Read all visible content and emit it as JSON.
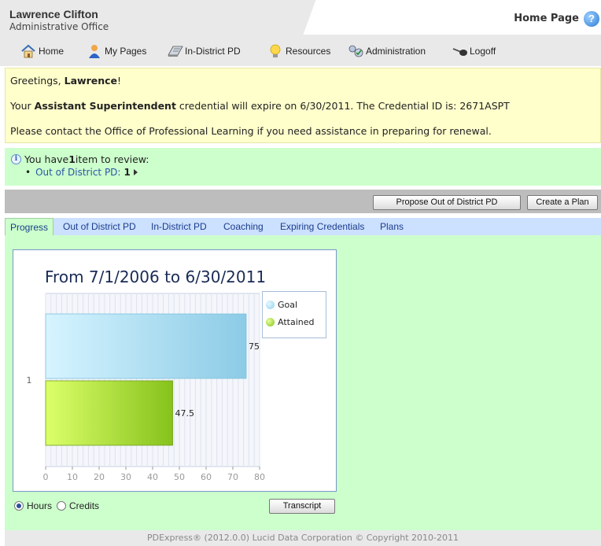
{
  "header": {
    "user_name": "Lawrence Clifton",
    "office": "Administrative Office",
    "page_title": "Home Page",
    "help_icon": "help-icon"
  },
  "nav": {
    "items": [
      {
        "label": "Home",
        "icon": "home-icon"
      },
      {
        "label": "My Pages",
        "icon": "user-icon"
      },
      {
        "label": "In-District PD",
        "icon": "book-icon"
      },
      {
        "label": "Resources",
        "icon": "lightbulb-icon"
      },
      {
        "label": "Administration",
        "icon": "admin-icon"
      },
      {
        "label": "Logoff",
        "icon": "key-icon"
      }
    ]
  },
  "greeting": {
    "hello_prefix": "Greetings, ",
    "name": "Lawrence",
    "hello_suffix": "!",
    "cred_prefix": "Your ",
    "cred_name": "Assistant Superintendent",
    "cred_suffix": " credential will expire on 6/30/2011. The Credential ID is: 2671ASPT",
    "contact": "Please contact the Office of Professional Learning if you need assistance in preparing for renewal."
  },
  "review": {
    "prefix": "You have ",
    "count": "1",
    "suffix": " item to review:",
    "items": [
      {
        "label": "Out of District PD:",
        "count": "1"
      }
    ]
  },
  "toolbar": {
    "propose_label": "Propose Out of District PD",
    "plan_label": "Create a Plan"
  },
  "tabs": [
    "Progress",
    "Out of District PD",
    "In-District PD",
    "Coaching",
    "Expiring Credentials",
    "Plans"
  ],
  "active_tab": "Progress",
  "options": {
    "hours_label": "Hours",
    "credits_label": "Credits",
    "selected": "Hours",
    "transcript_label": "Transcript"
  },
  "colors": {
    "goal": "#a8dcf0",
    "attained": "#9cd42a",
    "greeting_bg": "#ffffcc",
    "content_bg": "#ccffcc",
    "tab_bg": "#cce0ff"
  },
  "chart_data": {
    "type": "bar",
    "orientation": "horizontal",
    "title": "From 7/1/2006 to 6/30/2011",
    "categories": [
      "1"
    ],
    "series": [
      {
        "name": "Goal",
        "values": [
          75
        ]
      },
      {
        "name": "Attained",
        "values": [
          47.5
        ]
      }
    ],
    "xlim": [
      0,
      80
    ],
    "xticks": [
      0,
      10,
      20,
      30,
      40,
      50,
      60,
      70,
      80
    ],
    "grid": true,
    "legend": "top-right"
  },
  "footer": {
    "text": "PDExpress® (2012.0.0) Lucid Data Corporation © Copyright 2010-2011"
  }
}
